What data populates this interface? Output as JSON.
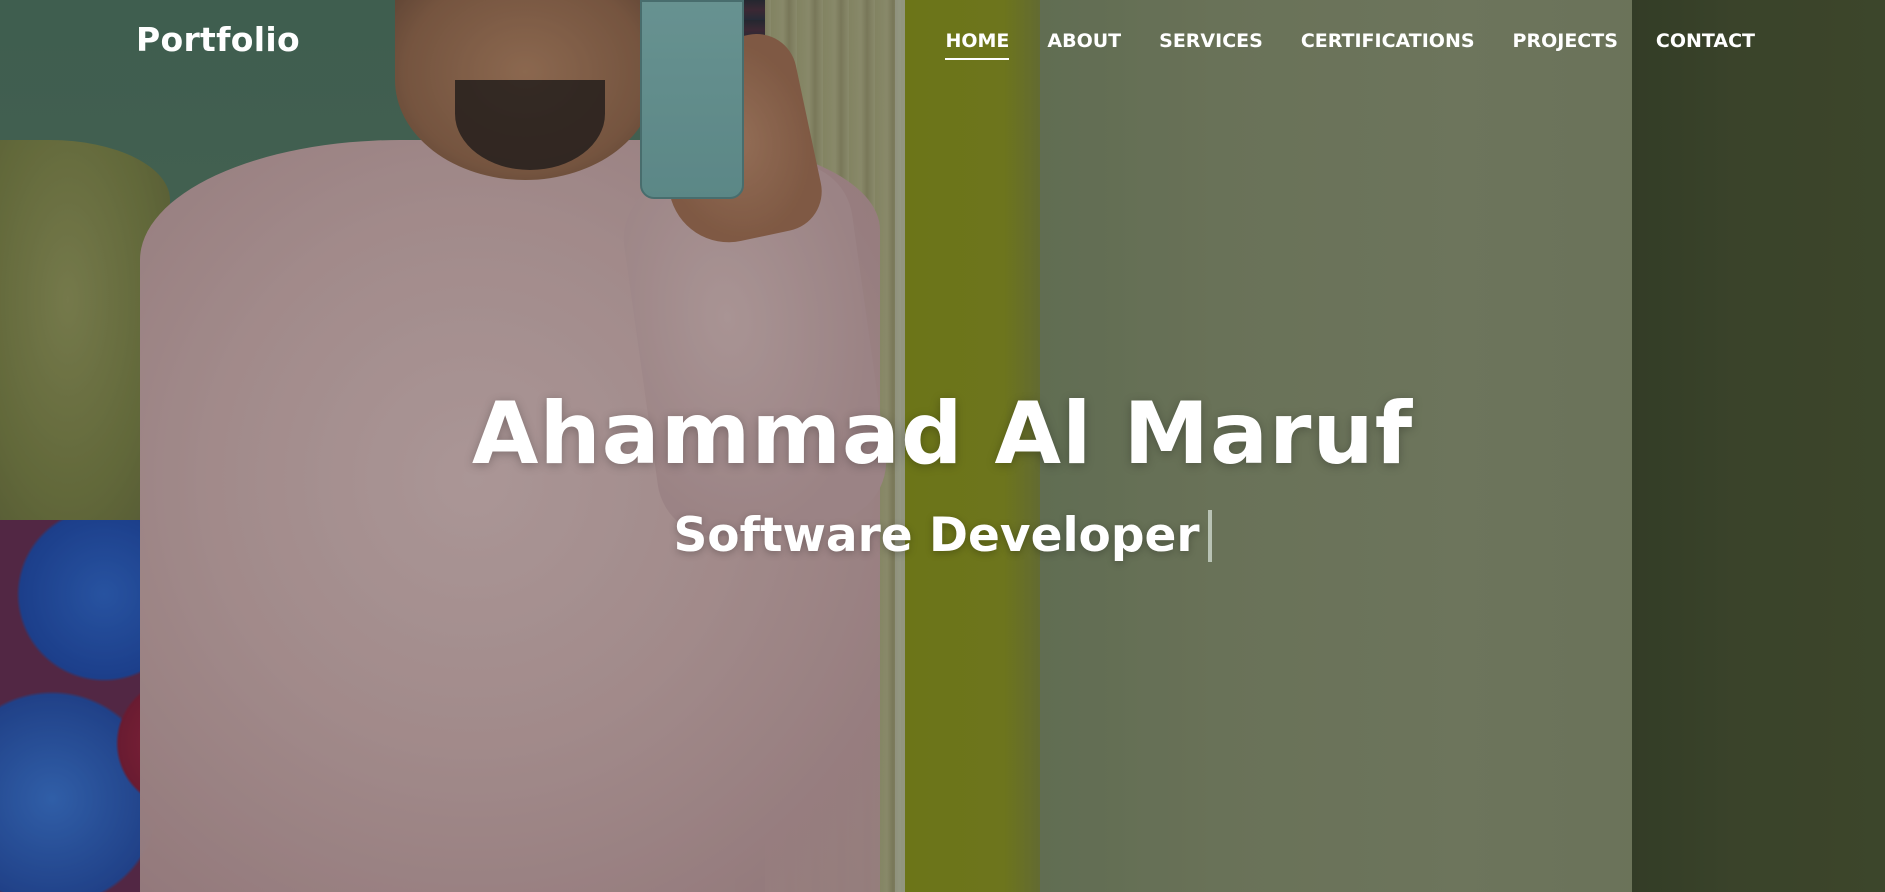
{
  "header": {
    "brand": "Portfolio",
    "nav": [
      {
        "label": "HOME",
        "active": true
      },
      {
        "label": "ABOUT",
        "active": false
      },
      {
        "label": "SERVICES",
        "active": false
      },
      {
        "label": "CERTIFICATIONS",
        "active": false
      },
      {
        "label": "PROJECTS",
        "active": false
      },
      {
        "label": "CONTACT",
        "active": false
      }
    ]
  },
  "hero": {
    "name": "Ahammad Al Maruf",
    "role": "Software Developer",
    "background_image": "person-taking-mirror-selfie-photo"
  },
  "colors": {
    "text": "#ffffff",
    "overlay": "rgba(20,20,20,0.28)",
    "cursor": "#b9c3b5"
  }
}
